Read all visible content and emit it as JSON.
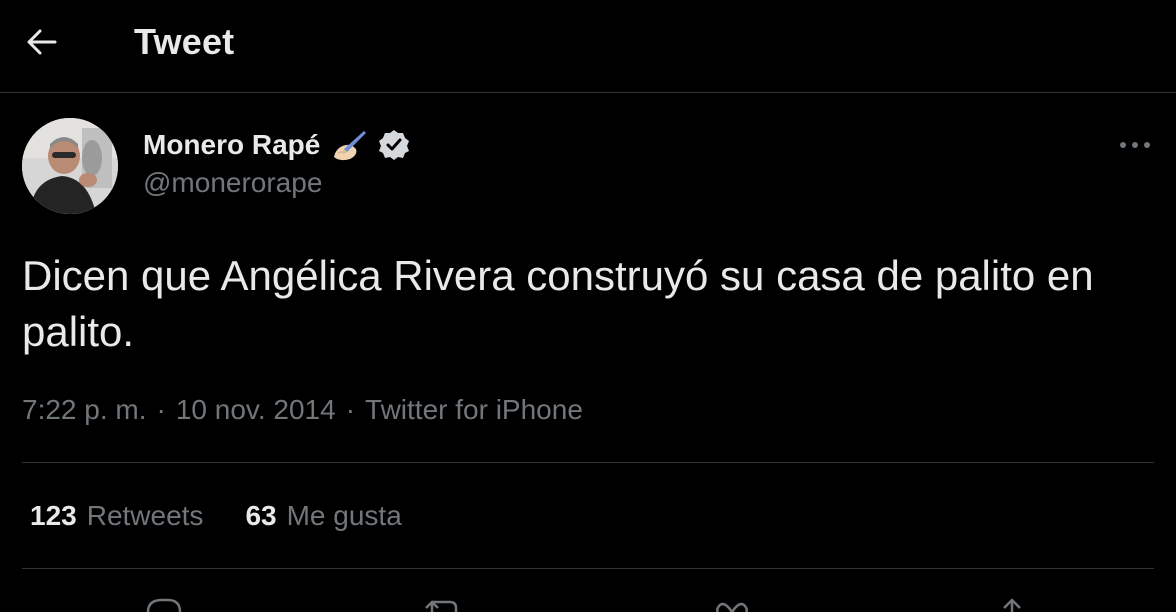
{
  "header": {
    "back_icon": "arrow-left-icon",
    "title": "Tweet"
  },
  "author": {
    "name": "Monero Rapé",
    "emoji_icon": "writing-hand-icon",
    "verified_icon": "verified-badge-icon",
    "handle": "@monerorape",
    "more_icon": "more-horizontal-icon"
  },
  "tweet": {
    "text": "Dicen que Angélica Rivera construyó su casa de palito en palito.",
    "time": "7:22 p. m.",
    "date": "10 nov. 2014",
    "separator": "·",
    "source": "Twitter for iPhone"
  },
  "stats": {
    "retweets_count": "123",
    "retweets_label": "Retweets",
    "likes_count": "63",
    "likes_label": "Me gusta"
  },
  "actions": [
    "reply-icon",
    "retweet-icon",
    "like-icon",
    "share-icon"
  ],
  "colors": {
    "background": "#000000",
    "text_primary": "#e7e9ea",
    "text_secondary": "#71767b",
    "divider": "#2f3336"
  }
}
